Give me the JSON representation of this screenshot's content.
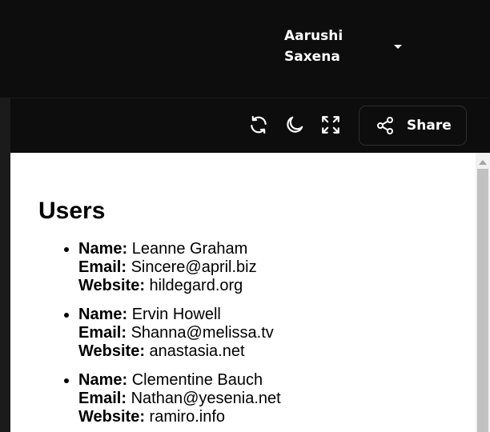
{
  "header": {
    "user_name": "Aarushi Saxena"
  },
  "toolbar": {
    "icons": [
      "refresh-icon",
      "moon-icon",
      "fullscreen-icon"
    ],
    "share_label": "Share"
  },
  "content": {
    "title": "Users",
    "labels": {
      "name": "Name:",
      "email": "Email:",
      "website": "Website:"
    },
    "users": [
      {
        "name": "Leanne Graham",
        "email": "Sincere@april.biz",
        "website": "hildegard.org"
      },
      {
        "name": "Ervin Howell",
        "email": "Shanna@melissa.tv",
        "website": "anastasia.net"
      },
      {
        "name": "Clementine Bauch",
        "email": "Nathan@yesenia.net",
        "website": "ramiro.info"
      }
    ]
  },
  "colors": {
    "background": "#0d0d0d",
    "content_bg": "#ffffff",
    "text_light": "#ffffff"
  }
}
